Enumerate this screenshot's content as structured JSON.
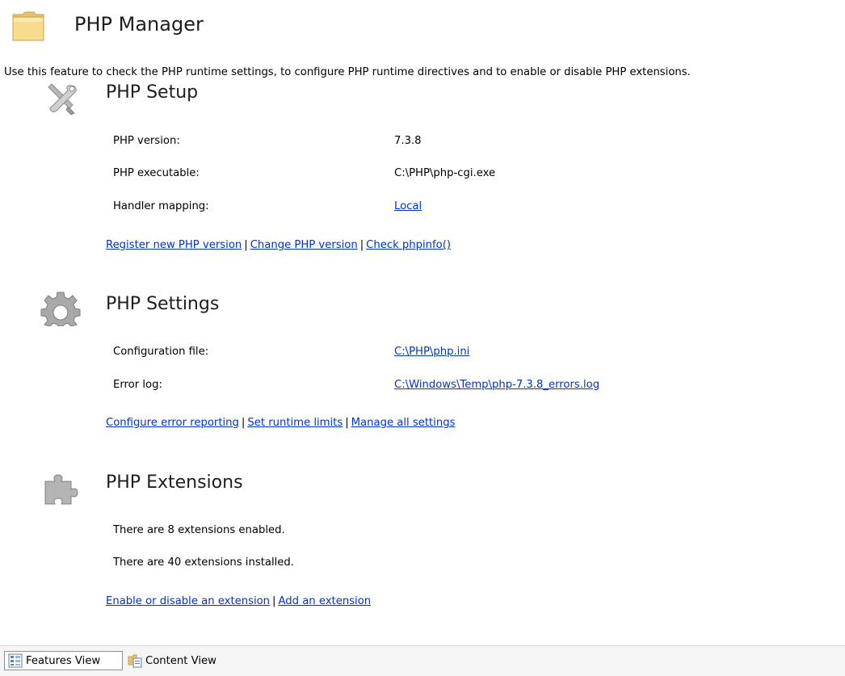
{
  "header": {
    "title": "PHP Manager",
    "icon": "folder-icon"
  },
  "description": "Use this feature to check the PHP runtime settings, to configure PHP runtime directives and to enable or disable PHP extensions.",
  "setup": {
    "title": "PHP Setup",
    "icon": "tools-icon",
    "rows": [
      {
        "label": "PHP version:",
        "value": "7.3.8"
      },
      {
        "label": "PHP executable:",
        "value": "C:\\PHP\\php-cgi.exe"
      },
      {
        "label": "Handler mapping:",
        "value": "Local"
      }
    ],
    "actions": [
      "Register new PHP version",
      "Change PHP version",
      "Check phpinfo()"
    ]
  },
  "settings": {
    "title": "PHP Settings",
    "icon": "gear-icon",
    "rows": [
      {
        "label": "Configuration file:",
        "value": "C:\\PHP\\php.ini"
      },
      {
        "label": "Error log:",
        "value": "C:\\Windows\\Temp\\php-7.3.8_errors.log"
      }
    ],
    "actions": [
      "Configure error reporting",
      "Set runtime limits",
      "Manage all settings"
    ]
  },
  "extensions": {
    "title": "PHP Extensions",
    "icon": "puzzle-icon",
    "lines": [
      "There are 8 extensions enabled.",
      "There are 40 extensions installed."
    ],
    "actions": [
      "Enable or disable an extension",
      "Add an extension"
    ]
  },
  "statusbar": {
    "tabs": [
      {
        "label": "Features View",
        "icon": "features-view-icon",
        "active": true
      },
      {
        "label": "Content View",
        "icon": "content-view-icon",
        "active": false
      }
    ]
  },
  "colors": {
    "link": "#0033cc",
    "folder": "#f3d98a"
  }
}
